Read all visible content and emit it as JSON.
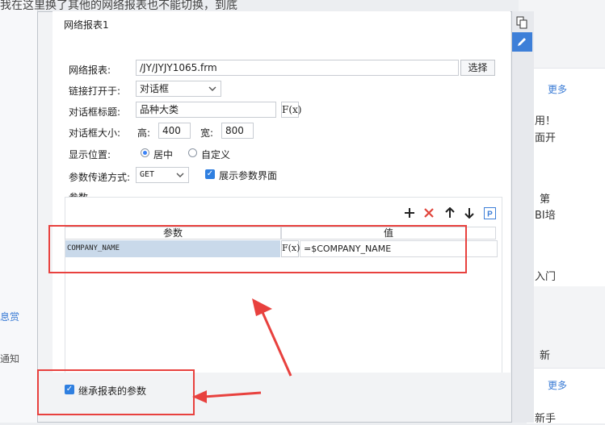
{
  "background": {
    "top_text": "我在这里换了其他的网络报表也不能切换，到底",
    "left_items": [
      "息赏",
      "通知"
    ],
    "right_more_1": "更多",
    "right_more_2": "更多",
    "right_fragments": [
      "用！",
      "面开",
      "第",
      "BI培",
      "入门",
      "新",
      "新手"
    ]
  },
  "dialog": {
    "title": "网络报表1",
    "report_label": "网络报表:",
    "report_value": "/JY/JYJY1065.frm",
    "choose_button": "选择",
    "link_open_label": "链接打开于:",
    "link_open_value": "对话框",
    "dialog_title_label": "对话框标题:",
    "dialog_title_value": "品种大类",
    "fx_label": "F(x)",
    "size_label": "对话框大小:",
    "height_label": "高:",
    "height_value": "400",
    "width_label": "宽:",
    "width_value": "800",
    "position_label": "显示位置:",
    "position_center": "居中",
    "position_custom": "自定义",
    "param_method_label": "参数传递方式:",
    "param_method_value": "GET",
    "show_param_label": "展示参数界面",
    "params_section_label": "参数",
    "table": {
      "headers": [
        "参数",
        "值"
      ],
      "rows": [
        {
          "param": "COMPANY_NAME",
          "value": "=$COMPANY_NAME"
        }
      ]
    },
    "inherit_label": "继承报表的参数"
  },
  "colors": {
    "accent": "#3d7fd8",
    "annotation_red": "#e8413e"
  },
  "icons": {
    "sidebar_top": "copy-icon",
    "sidebar_active": "pencil-icon",
    "add": "plus-icon",
    "delete": "x-icon",
    "up": "arrow-up-icon",
    "down": "arrow-down-icon",
    "p": "p-icon"
  }
}
